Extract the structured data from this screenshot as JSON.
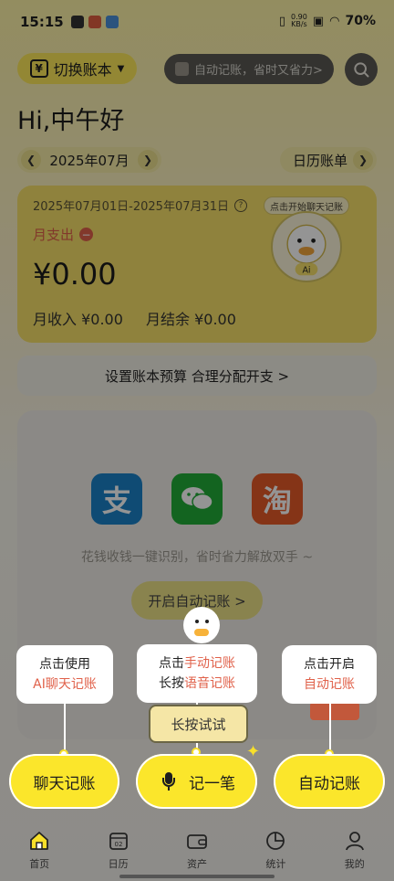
{
  "status_bar": {
    "time": "15:15",
    "net_speed": "0.90",
    "net_unit": "KB/s",
    "battery": "70%"
  },
  "header": {
    "switch_book": "切换账本",
    "auto_search_placeholder": "自动记账，省时又省力>",
    "greeting": "Hi,中午好"
  },
  "period": {
    "month": "2025年07月",
    "calendar_bill": "日历账单"
  },
  "summary": {
    "date_range": "2025年07月01日-2025年07月31日",
    "chat_tag": "点击开始聊天记账",
    "month_expense_label": "月支出",
    "amount": "¥0.00",
    "month_income": "月收入 ¥0.00",
    "month_balance": "月结余 ¥0.00",
    "mascot_badge": "Ai"
  },
  "budget_text": "设置账本预算 合理分配开支 >",
  "auto_card": {
    "apps": [
      {
        "name": "alipay",
        "glyph": "支"
      },
      {
        "name": "wechat",
        "glyph": ""
      },
      {
        "name": "taobao",
        "glyph": "淘"
      }
    ],
    "hint": "花钱收钱一键识别，省时省力解放双手 ~",
    "open_button": "开启自动记账 >"
  },
  "guide": {
    "bubble_chat": {
      "line1": "点击使用",
      "line2": "AI聊天记账"
    },
    "bubble_record": {
      "l1_prefix": "点击",
      "l1_hl": "手动记账",
      "l2_prefix": "长按",
      "l2_hl": "语音记账"
    },
    "bubble_auto": {
      "line1": "点击开启",
      "line2": "自动记账"
    },
    "press_try": "长按试试"
  },
  "actions": {
    "chat": "聊天记账",
    "record": "记一笔",
    "auto": "自动记账"
  },
  "nav": [
    {
      "label": "首页",
      "icon": "home-icon"
    },
    {
      "label": "日历",
      "icon": "calendar-icon"
    },
    {
      "label": "资产",
      "icon": "wallet-icon"
    },
    {
      "label": "统计",
      "icon": "pie-chart-icon"
    },
    {
      "label": "我的",
      "icon": "user-icon"
    }
  ],
  "colors": {
    "accent_yellow": "#fbe62b",
    "highlight_red": "#e0614a"
  }
}
